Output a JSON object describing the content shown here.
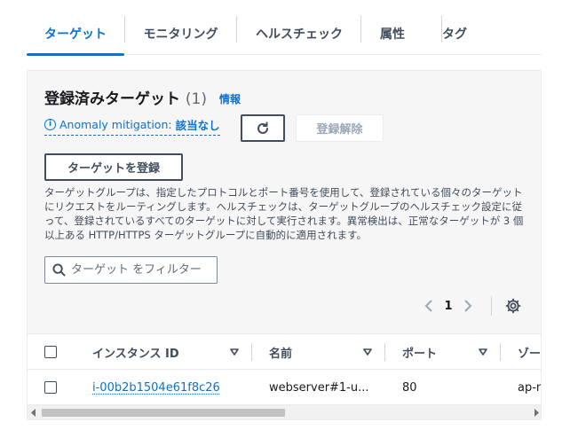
{
  "tabs": [
    {
      "label": "ターゲット",
      "active": true
    },
    {
      "label": "モニタリング"
    },
    {
      "label": "ヘルスチェック"
    },
    {
      "label": "属性"
    },
    {
      "label": "タグ"
    }
  ],
  "panel": {
    "title": "登録済みターゲット",
    "count": "(1)",
    "info_link": "情報",
    "anomaly_prefix": "Anomaly mitigation: ",
    "anomaly_value": "該当なし",
    "deregister_label": "登録解除",
    "register_label": "ターゲットを登録",
    "description": "ターゲットグループは、指定したプロトコルとポート番号を使用して、登録されている個々のターゲットにリクエストをルーティングします。ヘルスチェックは、ターゲットグループのヘルスチェック設定に従って、登録されているすべてのターゲットに対して実行されます。異常検出は、正常なターゲットが 3 個以上ある HTTP/HTTPS ターゲットグループに自動的に適用されます。",
    "filter_placeholder": "ターゲット をフィルター",
    "current_page": "1"
  },
  "table": {
    "columns": [
      "インスタンス ID",
      "名前",
      "ポート",
      "ゾー"
    ],
    "rows": [
      {
        "instance_id": "i-00b2b1504e61f8c26",
        "name": "webserver#1-u...",
        "port": "80",
        "zone": "ap-n"
      }
    ]
  },
  "colors": {
    "accent": "#0972d3",
    "text": "#16191f",
    "muted": "#414d5c"
  },
  "icons": [
    "info-icon",
    "refresh-icon",
    "search-icon",
    "chevron-left-icon",
    "chevron-right-icon",
    "gear-icon",
    "sort-icon"
  ]
}
